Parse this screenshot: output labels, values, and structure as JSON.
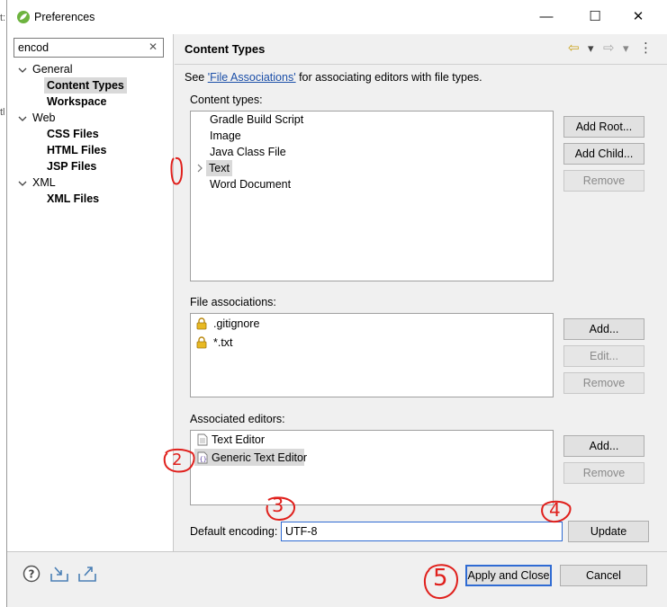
{
  "window": {
    "title": "Preferences",
    "controls": {
      "minimize": "—",
      "maximize": "☐",
      "close": "✕"
    }
  },
  "edge_fragments": [
    "t:",
    "tl"
  ],
  "sidebar": {
    "filter_value": "encod",
    "filter_clear": "✕",
    "tree": [
      {
        "label": "General",
        "level": 0,
        "expanded": true
      },
      {
        "label": "Content Types",
        "level": 1,
        "selected": true
      },
      {
        "label": "Workspace",
        "level": 1
      },
      {
        "label": "Web",
        "level": 0,
        "expanded": true
      },
      {
        "label": "CSS Files",
        "level": 1
      },
      {
        "label": "HTML Files",
        "level": 1
      },
      {
        "label": "JSP Files",
        "level": 1
      },
      {
        "label": "XML",
        "level": 0,
        "expanded": true
      },
      {
        "label": "XML Files",
        "level": 1
      }
    ]
  },
  "page": {
    "title": "Content Types",
    "description_prefix": "See ",
    "description_link": "'File Associations'",
    "description_suffix": " for associating editors with file types.",
    "nav": {
      "back": "⇦",
      "back_menu": "▾",
      "forward": "⇨",
      "forward_menu": "▾",
      "more": "⋮"
    }
  },
  "content_types": {
    "label": "Content types:",
    "items": [
      "Gradle Build Script",
      "Image",
      "Java Class File",
      "Text",
      "Word Document"
    ],
    "selected": "Text",
    "buttons": {
      "add_root": "Add Root...",
      "add_child": "Add Child...",
      "remove": "Remove"
    }
  },
  "file_associations": {
    "label": "File associations:",
    "items": [
      ".gitignore",
      "*.txt"
    ],
    "buttons": {
      "add": "Add...",
      "edit": "Edit...",
      "remove": "Remove"
    }
  },
  "associated_editors": {
    "label": "Associated editors:",
    "items": [
      "Text Editor",
      "Generic Text Editor"
    ],
    "buttons": {
      "add": "Add...",
      "remove": "Remove"
    }
  },
  "encoding": {
    "label": "Default encoding:",
    "value": "UTF-8",
    "update": "Update"
  },
  "footer": {
    "apply_close": "Apply and Close",
    "cancel": "Cancel"
  },
  "annotations": {
    "mark_2": "2",
    "mark_3": "3",
    "mark_4": "4",
    "mark_5": "5"
  },
  "colors": {
    "accent": "#2f6bd3",
    "link": "#1c4fa8",
    "annotation": "#e0201c",
    "selection": "#d9d9d9"
  }
}
